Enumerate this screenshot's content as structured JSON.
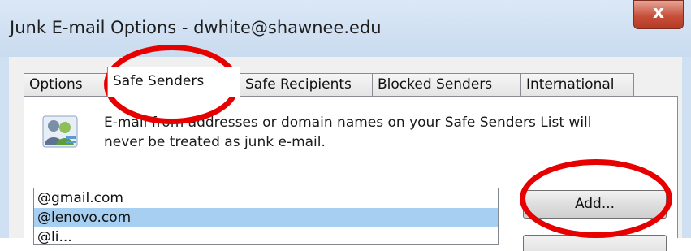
{
  "window": {
    "title": "Junk E-mail Options - dwhite@shawnee.edu",
    "close_glyph": "x"
  },
  "tabs": [
    {
      "label": "Options",
      "active": false
    },
    {
      "label": "Safe Senders",
      "active": true
    },
    {
      "label": "Safe Recipients",
      "active": false
    },
    {
      "label": "Blocked Senders",
      "active": false
    },
    {
      "label": "International",
      "active": false
    }
  ],
  "panel": {
    "icon": "users-icon",
    "info_line1": "E-mail from addresses or domain names on your Safe Senders List will",
    "info_line2": "never be treated as junk e-mail."
  },
  "safe_senders_list": [
    {
      "text": "@gmail.com",
      "selected": false
    },
    {
      "text": "@lenovo.com",
      "selected": true
    },
    {
      "text": "@li...",
      "selected": false
    }
  ],
  "buttons": {
    "add_label": "Add..."
  },
  "colors": {
    "annotation": "#e60000",
    "selection": "#a7cff1",
    "close_button": "#c7503a"
  }
}
